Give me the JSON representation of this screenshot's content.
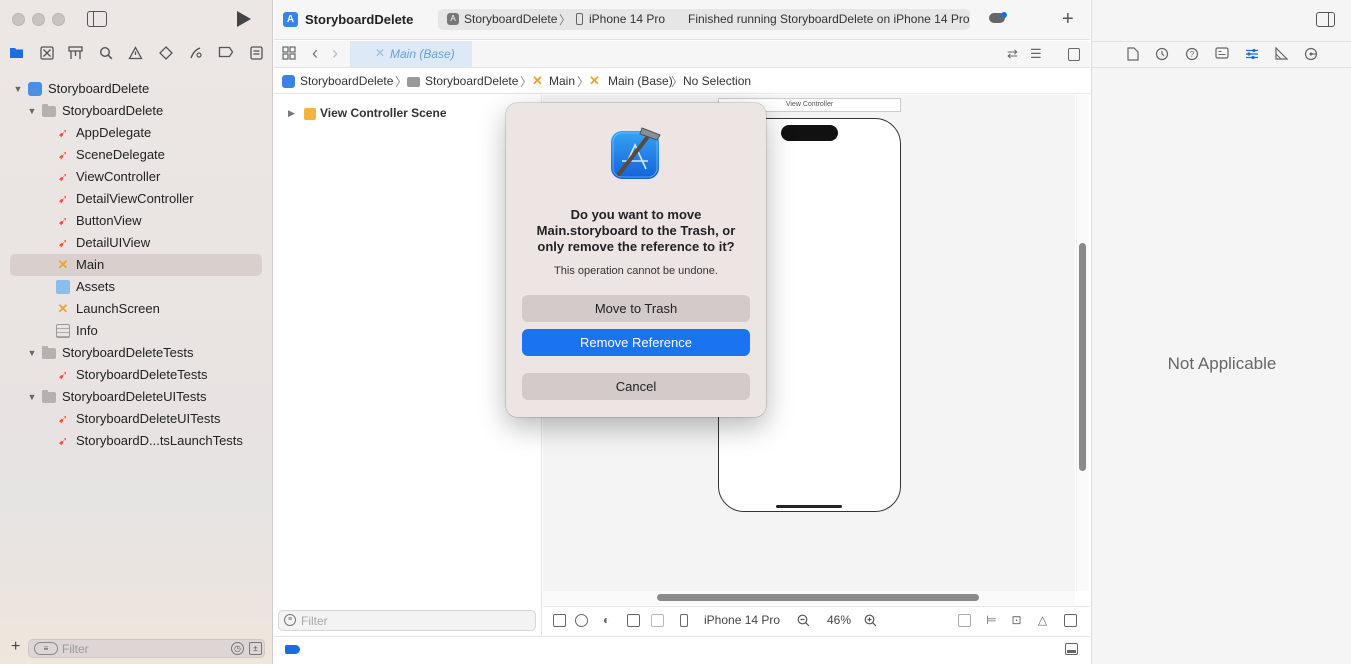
{
  "window": {
    "project_title": "StoryboardDelete"
  },
  "toolbar": {
    "scheme_name": "StoryboardDelete",
    "scheme_separator": "〉",
    "device_name": "iPhone 14 Pro",
    "status": "Finished running StoryboardDelete on iPhone 14 Pro",
    "add_label": "+"
  },
  "navigator": {
    "tree": [
      {
        "label": "StoryboardDelete",
        "kind": "project",
        "level": 0,
        "expanded": true
      },
      {
        "label": "StoryboardDelete",
        "kind": "folder",
        "level": 1,
        "expanded": true
      },
      {
        "label": "AppDelegate",
        "kind": "swift",
        "level": 2
      },
      {
        "label": "SceneDelegate",
        "kind": "swift",
        "level": 2
      },
      {
        "label": "ViewController",
        "kind": "swift",
        "level": 2
      },
      {
        "label": "DetailViewController",
        "kind": "swift",
        "level": 2
      },
      {
        "label": "ButtonView",
        "kind": "swift",
        "level": 2
      },
      {
        "label": "DetailUIView",
        "kind": "swift",
        "level": 2
      },
      {
        "label": "Main",
        "kind": "storyboard",
        "level": 2,
        "selected": true
      },
      {
        "label": "Assets",
        "kind": "xcassets",
        "level": 2
      },
      {
        "label": "LaunchScreen",
        "kind": "storyboard",
        "level": 2
      },
      {
        "label": "Info",
        "kind": "plist",
        "level": 2
      },
      {
        "label": "StoryboardDeleteTests",
        "kind": "folder",
        "level": 1,
        "expanded": true
      },
      {
        "label": "StoryboardDeleteTests",
        "kind": "swift",
        "level": 2
      },
      {
        "label": "StoryboardDeleteUITests",
        "kind": "folder",
        "level": 1,
        "expanded": true
      },
      {
        "label": "StoryboardDeleteUITests",
        "kind": "swift",
        "level": 2
      },
      {
        "label": "StoryboardD...tsLaunchTests",
        "kind": "swift",
        "level": 2
      }
    ],
    "filter_placeholder": "Filter",
    "add_label": "+"
  },
  "editor": {
    "tab_label": "Main (Base)",
    "jumpbar": {
      "project": "StoryboardDelete",
      "group": "StoryboardDelete",
      "file": "Main",
      "localization": "Main (Base)",
      "selection": "No Selection",
      "separator": "〉"
    },
    "outline": {
      "scene_label": "View Controller Scene",
      "filter_placeholder": "Filter"
    },
    "canvas": {
      "vc_title": "View Controller"
    },
    "bottom_bar": {
      "device": "iPhone 14 Pro",
      "zoom": "46%"
    }
  },
  "inspector": {
    "empty_text": "Not Applicable"
  },
  "dialog": {
    "title": "Do you want to move Main.storyboard to the Trash, or only remove the reference to it?",
    "message": "This operation cannot be undone.",
    "buttons": {
      "move_to_trash": "Move to Trash",
      "remove_reference": "Remove Reference",
      "cancel": "Cancel"
    }
  },
  "colors": {
    "accent": "#1a73f0",
    "storyboard_icon": "#e8a530",
    "swift_icon": "#f05138"
  },
  "icons": {
    "navigator_tabs": [
      "folder-icon",
      "source-control-icon",
      "symbol-icon",
      "find-icon",
      "issue-icon",
      "test-icon",
      "debug-icon",
      "breakpoint-icon",
      "report-icon"
    ],
    "inspector_tabs": [
      "file-inspector-icon",
      "history-icon",
      "help-icon",
      "identity-icon",
      "attributes-icon",
      "size-icon",
      "connections-icon"
    ]
  }
}
